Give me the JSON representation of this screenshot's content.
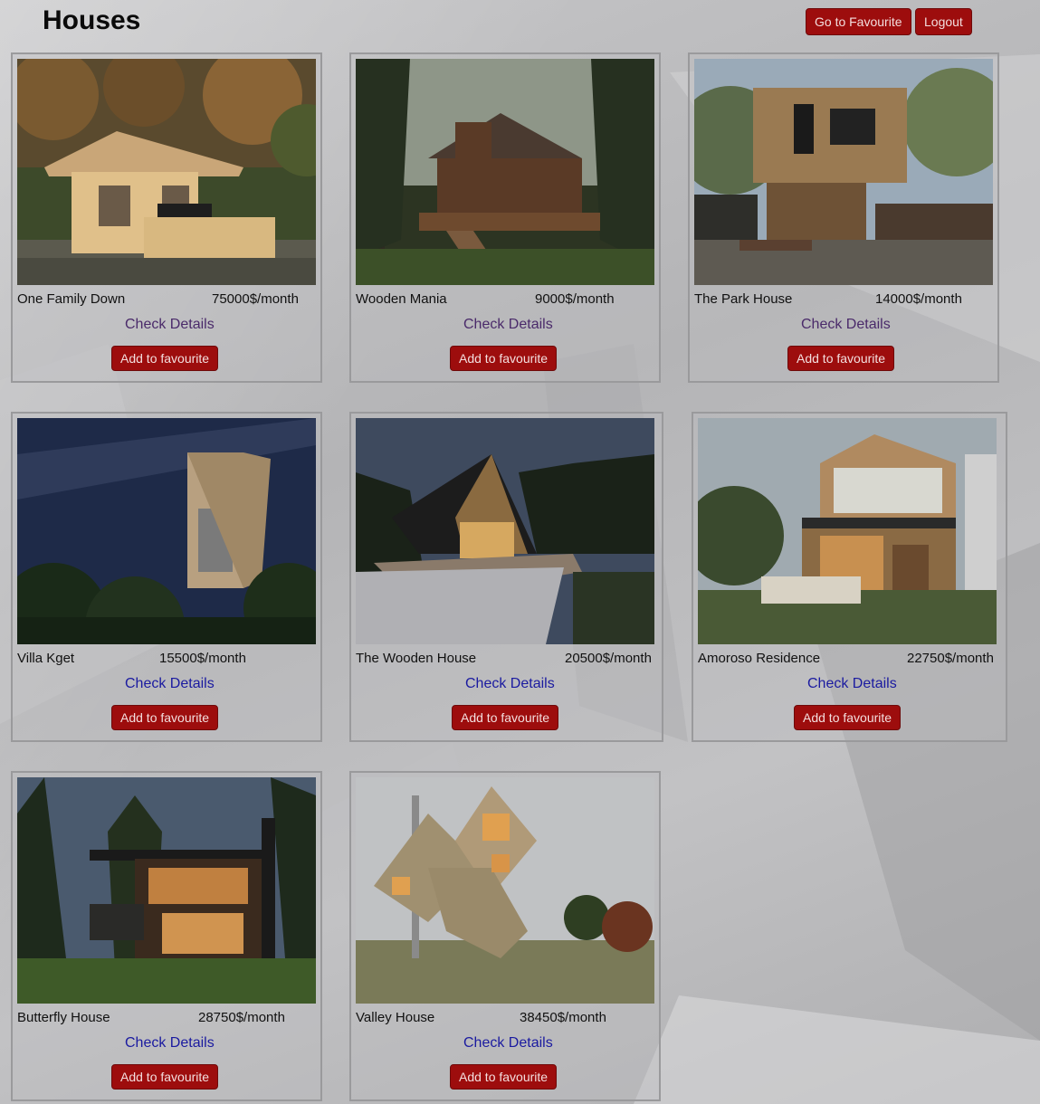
{
  "header": {
    "title": "Houses",
    "go_to_favourite": "Go to Favourite",
    "logout": "Logout"
  },
  "houses": [
    {
      "name": "One Family Down",
      "price": "75000$/month",
      "details": "Check Details",
      "fav": "Add to favourite",
      "details_visited": true,
      "photo": "log cabin with porch"
    },
    {
      "name": "Wooden Mania",
      "price": "9000$/month",
      "details": "Check Details",
      "fav": "Add to favourite",
      "details_visited": true,
      "photo": "log house in forest"
    },
    {
      "name": "The Park House",
      "price": "14000$/month",
      "details": "Check Details",
      "fav": "Add to favourite",
      "details_visited": true,
      "photo": "modern wooden cube house"
    },
    {
      "name": "Villa Kget",
      "price": "15500$/month",
      "details": "Check Details",
      "fav": "Add to favourite",
      "details_visited": false,
      "photo": "cantilevered villa at night"
    },
    {
      "name": "The Wooden House",
      "price": "20500$/month",
      "details": "Check Details",
      "fav": "Add to favourite",
      "details_visited": false,
      "photo": "a-frame house at dusk"
    },
    {
      "name": "Amoroso Residence",
      "price": "22750$/month",
      "details": "Check Details",
      "fav": "Add to favourite",
      "details_visited": false,
      "photo": "modern gabled residence"
    },
    {
      "name": "Butterfly House",
      "price": "28750$/month",
      "details": "Check Details",
      "fav": "Add to favourite",
      "details_visited": false,
      "photo": "dark modern house in trees"
    },
    {
      "name": "Valley House",
      "price": "38450$/month",
      "details": "Check Details",
      "fav": "Add to favourite",
      "details_visited": false,
      "photo": "geometric diamond cabin"
    }
  ],
  "colors": {
    "button": "#9d0d0d",
    "visited_link": "#4a2a6a",
    "link": "#1a1aa0"
  }
}
